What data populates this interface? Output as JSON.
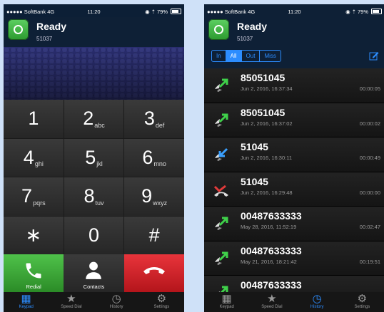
{
  "keypad_screen": {
    "status": {
      "carrier": "●●●●● SoftBank  4G",
      "time": "11:20",
      "battery": "79%"
    },
    "header": {
      "title": "Ready",
      "account": "51037"
    },
    "keys": [
      {
        "digit": "1",
        "letters": ""
      },
      {
        "digit": "2",
        "letters": "abc"
      },
      {
        "digit": "3",
        "letters": "def"
      },
      {
        "digit": "4",
        "letters": "ghi"
      },
      {
        "digit": "5",
        "letters": "jkl"
      },
      {
        "digit": "6",
        "letters": "mno"
      },
      {
        "digit": "7",
        "letters": "pqrs"
      },
      {
        "digit": "8",
        "letters": "tuv"
      },
      {
        "digit": "9",
        "letters": "wxyz"
      },
      {
        "digit": "∗",
        "letters": ""
      },
      {
        "digit": "0",
        "letters": ""
      },
      {
        "digit": "#",
        "letters": ""
      }
    ],
    "actions": {
      "redial": "Redial",
      "contacts": "Contacts"
    },
    "tabs": [
      "Keypad",
      "Speed Dial",
      "History",
      "Settings"
    ]
  },
  "history_screen": {
    "status": {
      "carrier": "●●●●● SoftBank  4G",
      "time": "11:20",
      "battery": "79%"
    },
    "header": {
      "title": "Ready",
      "account": "51037"
    },
    "filter": {
      "options": [
        "In",
        "All",
        "Out",
        "Miss"
      ],
      "selected": "All"
    },
    "calls": [
      {
        "number": "85051045",
        "date": "Jun 2, 2016, 16:37:34",
        "duration": "00:00:05",
        "kind": "outgoing"
      },
      {
        "number": "85051045",
        "date": "Jun 2, 2016, 16:37:02",
        "duration": "00:00:02",
        "kind": "outgoing"
      },
      {
        "number": "51045",
        "date": "Jun 2, 2016, 16:30:11",
        "duration": "00:00:49",
        "kind": "incoming"
      },
      {
        "number": "51045",
        "date": "Jun 2, 2016, 16:29:48",
        "duration": "00:00:00",
        "kind": "missed"
      },
      {
        "number": "00487633333",
        "date": "May 28, 2016, 11:52:19",
        "duration": "00:02:47",
        "kind": "outgoing"
      },
      {
        "number": "00487633333",
        "date": "May 21, 2016, 18:21:42",
        "duration": "00:19:51",
        "kind": "outgoing"
      },
      {
        "number": "00487633333",
        "date": "",
        "duration": "",
        "kind": "outgoing"
      }
    ],
    "tabs": [
      "Keypad",
      "Speed Dial",
      "History",
      "Settings"
    ],
    "active_tab": "History"
  },
  "colors": {
    "accent": "#2c8dff",
    "call_green": "#3fb43a",
    "hangup_red": "#d8232a",
    "header_bg": "#0e2036"
  }
}
